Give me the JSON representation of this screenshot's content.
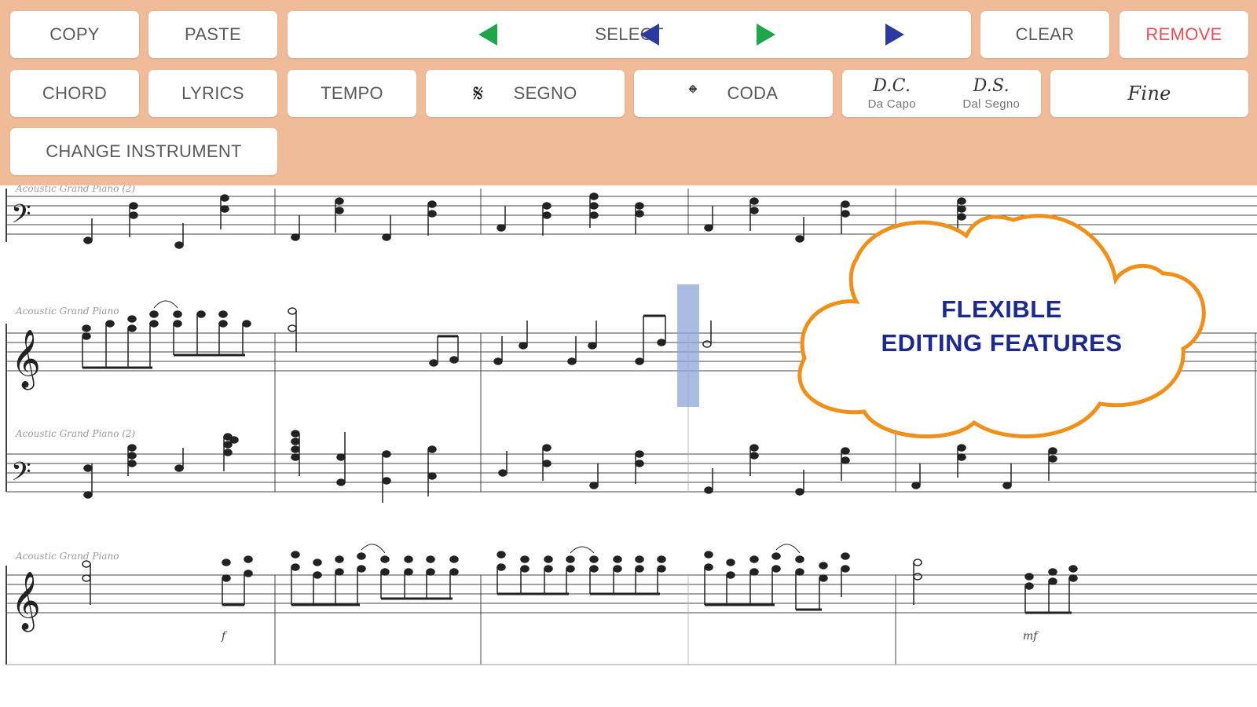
{
  "toolbar": {
    "copy": "COPY",
    "paste": "PASTE",
    "select": "SELECT",
    "clear": "CLEAR",
    "remove": "REMOVE",
    "chord": "CHORD",
    "lyrics": "LYRICS",
    "tempo": "TEMPO",
    "segno": "SEGNO",
    "coda": "CODA",
    "dc_big": "D.C.",
    "dc_small": "Da Capo",
    "ds_big": "D.S.",
    "ds_small": "Dal Segno",
    "fine": "Fine",
    "change_instrument": "CHANGE INSTRUMENT"
  },
  "icons": {
    "segno": "segno-icon",
    "coda": "coda-icon",
    "select_left_far": "triangle-left-blue",
    "select_left": "triangle-left-green",
    "select_right": "triangle-right-green",
    "select_right_far": "triangle-right-blue"
  },
  "score": {
    "instrument_labels": [
      "Acoustic Grand Piano (2)",
      "Acoustic Grand Piano",
      "Acoustic Grand Piano (2)",
      "Acoustic Grand Piano"
    ],
    "dynamic_marks": [
      "f",
      "mf"
    ]
  },
  "promo": {
    "line1": "FLEXIBLE",
    "line2": "EDITING FEATURES"
  },
  "colors": {
    "toolbar_bg": "#efbb99",
    "remove_text": "#e5505a",
    "nav_blue": "#2b3a9e",
    "nav_green": "#1fa64a",
    "cloud_outline": "#f0901c",
    "promo_text": "#1d2a8c",
    "selection": "#8fa6d8"
  }
}
